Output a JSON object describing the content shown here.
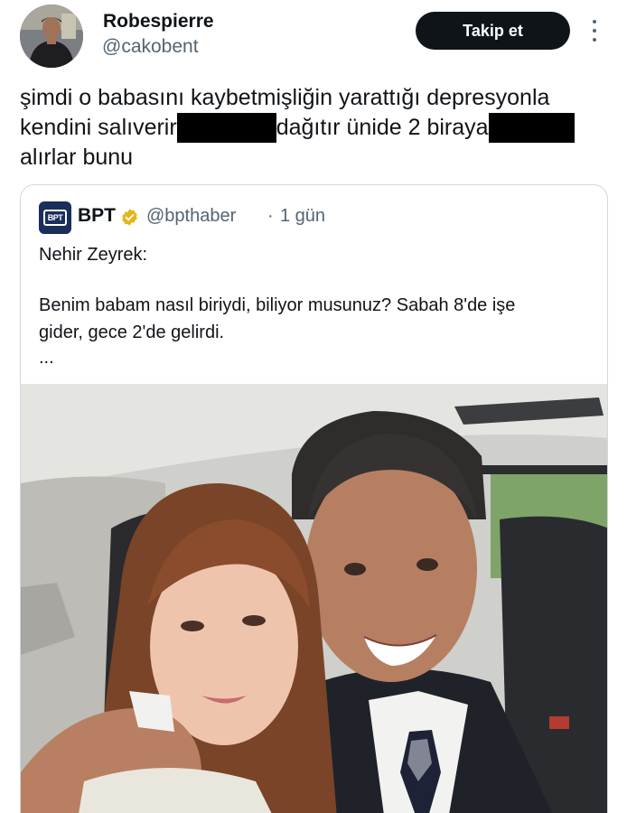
{
  "author": {
    "display_name": "Robespierre",
    "handle": "@cakobent",
    "follow_label": "Takip et"
  },
  "tweet": {
    "line1": "şimdi o babasını kaybetmişliğin yarattığı depresyonla",
    "line2_a": "kendini salıverir",
    "line2_b": "dağıtır ünide 2 biraya",
    "line3": "alırlar bunu"
  },
  "quote": {
    "logo_text": "BPT",
    "name": "BPT",
    "handle": "@bpthaber",
    "separator": "·",
    "time": "1 gün",
    "text_line1": "Nehir Zeyrek:",
    "text_line2": "Benim babam nasıl biriydi, biliyor musunuz? Sabah 8'de işe",
    "text_line3": "gider, gece 2'de gelirdi.",
    "text_line4": "..."
  },
  "icons": {
    "verified": "verified-badge-icon",
    "more": "more-options-icon"
  },
  "colors": {
    "follow_button": "#0f1419",
    "secondary_text": "#536471",
    "verified": "#e2b719",
    "bpt_brand": "#1a2d5c"
  }
}
